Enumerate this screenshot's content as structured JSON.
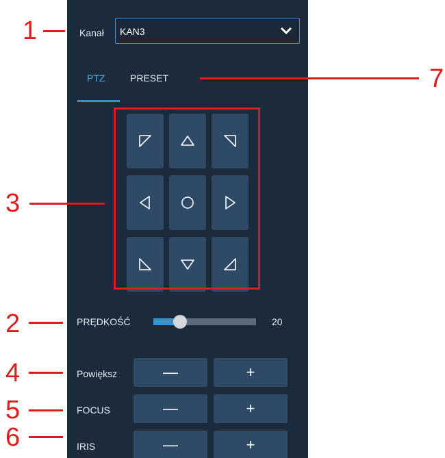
{
  "channel": {
    "label": "Kanał",
    "value": "KAN3"
  },
  "tabs": [
    {
      "label": "PTZ",
      "active": true
    },
    {
      "label": "PRESET",
      "active": false
    }
  ],
  "ptz_pad": {
    "buttons": [
      "up-left-arrow-icon",
      "up-arrow-icon",
      "up-right-arrow-icon",
      "left-arrow-icon",
      "center-circle-icon",
      "right-arrow-icon",
      "down-left-arrow-icon",
      "down-arrow-icon",
      "down-right-arrow-icon"
    ]
  },
  "speed": {
    "label": "PRĘDKOŚĆ",
    "value": "20",
    "fraction": 0.26
  },
  "controls": [
    {
      "label": "Powiększ",
      "minus": "—",
      "plus": "+"
    },
    {
      "label": "FOCUS",
      "minus": "—",
      "plus": "+"
    },
    {
      "label": "IRIS",
      "minus": "—",
      "plus": "+"
    }
  ],
  "annotations": [
    "1",
    "7",
    "3",
    "2",
    "4",
    "5",
    "6"
  ],
  "colors": {
    "panel": "#1c2b3b",
    "button": "#2e4a66",
    "accent": "#3e8fd0",
    "annotation": "#e01b1b"
  }
}
